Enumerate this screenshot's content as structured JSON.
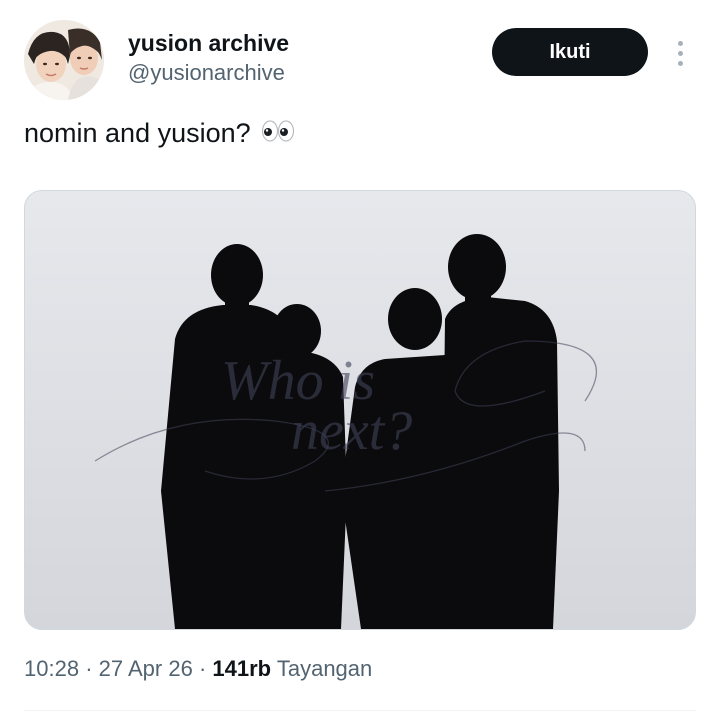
{
  "author": {
    "display_name": "yusion archive",
    "handle": "@yusionarchive"
  },
  "header": {
    "follow_label": "Ikuti",
    "more_icon": "more-vertical-icon"
  },
  "tweet": {
    "text": "nomin and yusion?",
    "emoji_icon": "eyes-emoji-icon"
  },
  "media": {
    "overlay_line1": "Who is",
    "overlay_line2": "next?"
  },
  "meta": {
    "time": "10:28",
    "sep1": "·",
    "date": "27 Apr 26",
    "sep2": "·",
    "views_count": "141rb",
    "views_label": "Tayangan"
  },
  "colors": {
    "primary_text": "#0f1419",
    "secondary_text": "#536471",
    "button_bg": "#0f1419",
    "border": "#cfd9de"
  }
}
